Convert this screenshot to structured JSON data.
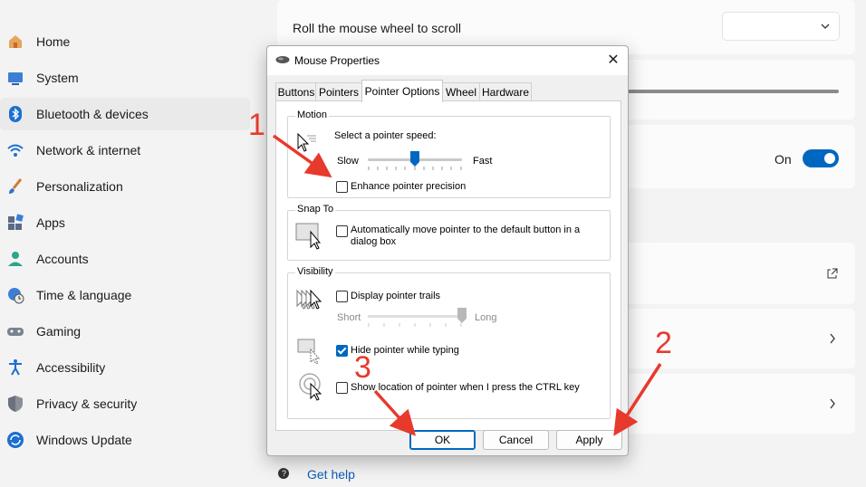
{
  "sidebar": {
    "items": [
      {
        "label": "Home",
        "icon": "home-icon"
      },
      {
        "label": "System",
        "icon": "system-icon"
      },
      {
        "label": "Bluetooth & devices",
        "icon": "bluetooth-icon"
      },
      {
        "label": "Network & internet",
        "icon": "wifi-icon"
      },
      {
        "label": "Personalization",
        "icon": "brush-icon"
      },
      {
        "label": "Apps",
        "icon": "apps-icon"
      },
      {
        "label": "Accounts",
        "icon": "person-icon"
      },
      {
        "label": "Time & language",
        "icon": "globe-clock-icon"
      },
      {
        "label": "Gaming",
        "icon": "gamepad-icon"
      },
      {
        "label": "Accessibility",
        "icon": "accessibility-icon"
      },
      {
        "label": "Privacy & security",
        "icon": "shield-icon"
      },
      {
        "label": "Windows Update",
        "icon": "update-icon"
      }
    ]
  },
  "main": {
    "scroll_label": "Roll the mouse wheel to scroll",
    "toggle_state": "On",
    "get_help": "Get help"
  },
  "dialog": {
    "title": "Mouse Properties",
    "tabs": [
      "Buttons",
      "Pointers",
      "Pointer Options",
      "Wheel",
      "Hardware"
    ],
    "motion": {
      "group": "Motion",
      "speed_label": "Select a pointer speed:",
      "slow": "Slow",
      "fast": "Fast",
      "speed_level": 0.5,
      "precision_label": "Enhance pointer precision",
      "precision_checked": false
    },
    "snap": {
      "group": "Snap To",
      "label_line1": "Automatically move pointer to the default button in a",
      "label_line2": "dialog box",
      "checked": false
    },
    "visibility": {
      "group": "Visibility",
      "trails_label": "Display pointer trails",
      "trails_checked": false,
      "short": "Short",
      "long": "Long",
      "trail_level": 1.0,
      "hide_label": "Hide pointer while typing",
      "hide_checked": true,
      "ctrl_label": "Show location of pointer when I press the CTRL key",
      "ctrl_checked": false
    },
    "buttons": {
      "ok": "OK",
      "cancel": "Cancel",
      "apply": "Apply"
    }
  },
  "annotations": {
    "one": "1",
    "two": "2",
    "three": "3"
  },
  "colors": {
    "accent": "#0067c0",
    "annotation": "#e8392d"
  }
}
